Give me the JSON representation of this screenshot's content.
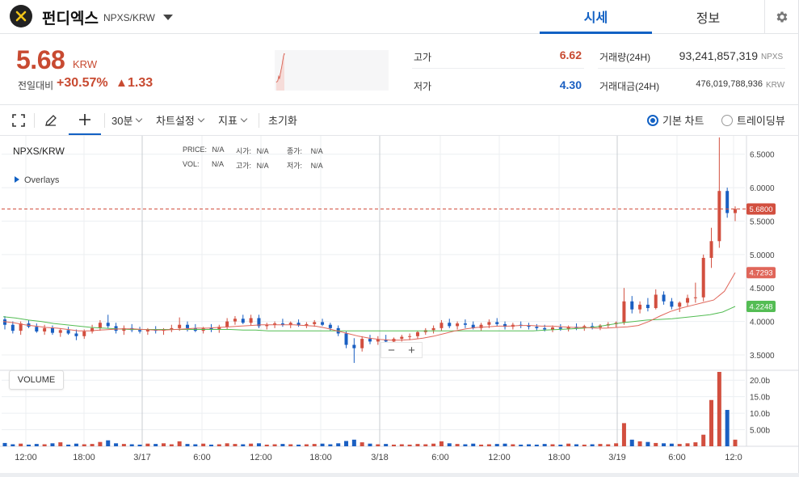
{
  "header": {
    "coin_name": "펀디엑스",
    "pair": "NPXS/KRW",
    "tabs": [
      "시세",
      "정보"
    ]
  },
  "summary": {
    "price": "5.68",
    "price_unit": "KRW",
    "change_label": "전일대비",
    "change_rate": "+30.57%",
    "change_arrow": "▲",
    "change_amount": "1.33",
    "high_label": "고가",
    "high_value": "6.62",
    "low_label": "저가",
    "low_value": "4.30",
    "volume_label": "거래량(24H)",
    "volume_value": "93,241,857,319",
    "volume_unit": "NPXS",
    "amount_label": "거래대금(24H)",
    "amount_value": "476,019,788,936",
    "amount_unit": "KRW"
  },
  "toolbar": {
    "interval": "30분",
    "chart_settings": "차트설정",
    "indicators": "지표",
    "reset": "초기화",
    "basic_chart": "기본 차트",
    "tradingview": "트레이딩뷰"
  },
  "chart": {
    "symbol": "NPXS/KRW",
    "ohlc_rows": [
      [
        {
          "k": "PRICE:",
          "v": "N/A"
        },
        {
          "k": "시가:",
          "v": "N/A"
        },
        {
          "k": "종가:",
          "v": "N/A"
        }
      ],
      [
        {
          "k": "VOL:",
          "v": "N/A"
        },
        {
          "k": "고가:",
          "v": "N/A"
        },
        {
          "k": "저가:",
          "v": "N/A"
        }
      ]
    ],
    "overlays_label": "Overlays",
    "volume_label": "VOLUME",
    "zoom_out": "−",
    "zoom_in": "+",
    "price_ticks": [
      "6.5000",
      "6.0000",
      "5.5000",
      "5.0000",
      "4.5000",
      "4.0000",
      "3.5000"
    ],
    "volume_ticks": [
      "20.0b",
      "15.0b",
      "10.0b",
      "5.00b"
    ],
    "time_ticks": [
      "12:00",
      "18:00",
      "3/17",
      "6:00",
      "12:00",
      "18:00",
      "3/18",
      "6:00",
      "12:00",
      "18:00",
      "3/19",
      "6:00",
      "12:0"
    ],
    "last_price_label": "5.6800",
    "ma_short_label": "4.7293",
    "ma_long_label": "4.2248",
    "colors": {
      "up": "#d24f3f",
      "down": "#1a5fc2",
      "ma_short": "#e0665a",
      "ma_long": "#54bd54",
      "last": "#d24f3f"
    }
  },
  "chart_data": {
    "type": "candlestick",
    "price_range": [
      3.27,
      6.75
    ],
    "volume_range_b": [
      0,
      22.5
    ],
    "last_price": 5.68,
    "ma_short_last": 4.7293,
    "ma_long_last": 4.2248,
    "ohlc": [
      [
        4.03,
        4.08,
        3.88,
        3.95
      ],
      [
        3.95,
        4.0,
        3.82,
        3.86
      ],
      [
        3.86,
        4.0,
        3.8,
        3.97
      ],
      [
        3.97,
        4.02,
        3.9,
        3.92
      ],
      [
        3.92,
        3.97,
        3.83,
        3.85
      ],
      [
        3.85,
        3.95,
        3.8,
        3.9
      ],
      [
        3.9,
        3.94,
        3.8,
        3.83
      ],
      [
        3.83,
        3.9,
        3.77,
        3.87
      ],
      [
        3.87,
        3.92,
        3.8,
        3.82
      ],
      [
        3.82,
        3.88,
        3.72,
        3.78
      ],
      [
        3.78,
        3.88,
        3.74,
        3.85
      ],
      [
        3.85,
        3.95,
        3.82,
        3.9
      ],
      [
        3.9,
        4.02,
        3.86,
        3.98
      ],
      [
        3.98,
        4.1,
        3.9,
        3.93
      ],
      [
        3.93,
        3.98,
        3.82,
        3.86
      ],
      [
        3.86,
        3.94,
        3.8,
        3.9
      ],
      [
        3.9,
        3.96,
        3.84,
        3.87
      ],
      [
        3.87,
        3.92,
        3.82,
        3.85
      ],
      [
        3.85,
        3.9,
        3.8,
        3.88
      ],
      [
        3.88,
        3.93,
        3.82,
        3.86
      ],
      [
        3.86,
        3.9,
        3.8,
        3.88
      ],
      [
        3.88,
        3.95,
        3.84,
        3.9
      ],
      [
        3.9,
        4.06,
        3.86,
        3.95
      ],
      [
        3.95,
        4.0,
        3.85,
        3.9
      ],
      [
        3.9,
        3.96,
        3.84,
        3.86
      ],
      [
        3.86,
        3.92,
        3.82,
        3.9
      ],
      [
        3.9,
        3.96,
        3.84,
        3.88
      ],
      [
        3.88,
        3.95,
        3.83,
        3.92
      ],
      [
        3.92,
        4.05,
        3.88,
        4.0
      ],
      [
        4.0,
        4.08,
        3.95,
        4.04
      ],
      [
        4.04,
        4.1,
        3.96,
        3.98
      ],
      [
        3.98,
        4.1,
        3.94,
        4.05
      ],
      [
        4.05,
        4.1,
        3.9,
        3.93
      ],
      [
        3.93,
        3.98,
        3.88,
        3.95
      ],
      [
        3.95,
        4.0,
        3.9,
        3.97
      ],
      [
        3.97,
        4.04,
        3.92,
        3.95
      ],
      [
        3.95,
        4.0,
        3.9,
        3.98
      ],
      [
        3.98,
        4.03,
        3.92,
        3.94
      ],
      [
        3.94,
        3.99,
        3.9,
        3.96
      ],
      [
        3.96,
        4.02,
        3.92,
        3.99
      ],
      [
        3.99,
        4.04,
        3.93,
        3.95
      ],
      [
        3.95,
        3.98,
        3.86,
        3.9
      ],
      [
        3.9,
        3.94,
        3.78,
        3.82
      ],
      [
        3.82,
        3.85,
        3.6,
        3.65
      ],
      [
        3.65,
        3.75,
        3.38,
        3.6
      ],
      [
        3.6,
        3.78,
        3.55,
        3.74
      ],
      [
        3.74,
        3.8,
        3.66,
        3.7
      ],
      [
        3.7,
        3.78,
        3.65,
        3.73
      ],
      [
        3.73,
        3.8,
        3.68,
        3.7
      ],
      [
        3.7,
        3.76,
        3.66,
        3.74
      ],
      [
        3.74,
        3.8,
        3.7,
        3.77
      ],
      [
        3.77,
        3.82,
        3.72,
        3.78
      ],
      [
        3.78,
        3.86,
        3.74,
        3.84
      ],
      [
        3.84,
        3.9,
        3.8,
        3.87
      ],
      [
        3.87,
        3.94,
        3.82,
        3.9
      ],
      [
        3.9,
        4.02,
        3.86,
        3.98
      ],
      [
        3.98,
        4.04,
        3.9,
        3.93
      ],
      [
        3.93,
        4.0,
        3.88,
        3.97
      ],
      [
        3.97,
        4.03,
        3.9,
        3.95
      ],
      [
        3.95,
        4.0,
        3.88,
        3.9
      ],
      [
        3.9,
        3.98,
        3.86,
        3.95
      ],
      [
        3.95,
        4.03,
        3.9,
        3.99
      ],
      [
        3.99,
        4.05,
        3.93,
        3.96
      ],
      [
        3.96,
        4.0,
        3.88,
        3.92
      ],
      [
        3.92,
        3.98,
        3.88,
        3.95
      ],
      [
        3.95,
        4.0,
        3.9,
        3.94
      ],
      [
        3.94,
        3.98,
        3.88,
        3.92
      ],
      [
        3.92,
        3.96,
        3.86,
        3.9
      ],
      [
        3.9,
        3.95,
        3.85,
        3.88
      ],
      [
        3.88,
        3.94,
        3.84,
        3.91
      ],
      [
        3.91,
        3.96,
        3.86,
        3.89
      ],
      [
        3.89,
        3.94,
        3.85,
        3.92
      ],
      [
        3.92,
        3.97,
        3.87,
        3.9
      ],
      [
        3.9,
        3.95,
        3.86,
        3.93
      ],
      [
        3.93,
        3.98,
        3.88,
        3.91
      ],
      [
        3.91,
        3.96,
        3.87,
        3.94
      ],
      [
        3.94,
        3.99,
        3.9,
        3.96
      ],
      [
        3.96,
        4.0,
        3.91,
        3.98
      ],
      [
        3.98,
        4.5,
        3.95,
        4.3
      ],
      [
        4.3,
        4.38,
        4.12,
        4.18
      ],
      [
        4.18,
        4.3,
        4.12,
        4.25
      ],
      [
        4.25,
        4.35,
        4.15,
        4.2
      ],
      [
        4.2,
        4.48,
        4.18,
        4.4
      ],
      [
        4.4,
        4.45,
        4.25,
        4.3
      ],
      [
        4.3,
        4.35,
        4.18,
        4.22
      ],
      [
        4.22,
        4.3,
        4.14,
        4.28
      ],
      [
        4.28,
        4.4,
        4.22,
        4.35
      ],
      [
        4.35,
        4.58,
        4.28,
        4.36
      ],
      [
        4.36,
        5.0,
        4.3,
        4.95
      ],
      [
        4.95,
        5.4,
        4.8,
        5.2
      ],
      [
        5.2,
        6.75,
        5.1,
        5.95
      ],
      [
        5.95,
        6.0,
        5.55,
        5.62
      ],
      [
        5.62,
        5.72,
        5.5,
        5.68
      ]
    ],
    "volume_b": [
      1.0,
      0.6,
      0.8,
      0.5,
      0.7,
      0.6,
      0.9,
      1.2,
      0.5,
      0.8,
      0.6,
      0.7,
      1.3,
      1.8,
      0.9,
      0.7,
      0.6,
      0.5,
      0.8,
      0.7,
      0.9,
      0.6,
      1.5,
      0.7,
      0.6,
      0.8,
      0.5,
      0.6,
      0.9,
      0.7,
      0.6,
      0.8,
      0.9,
      0.5,
      0.6,
      0.7,
      0.6,
      0.5,
      0.6,
      0.7,
      0.8,
      0.6,
      0.9,
      1.6,
      2.0,
      1.2,
      0.8,
      0.6,
      0.7,
      0.5,
      0.6,
      0.5,
      0.7,
      0.6,
      0.8,
      1.5,
      0.9,
      0.7,
      0.6,
      0.8,
      0.5,
      0.6,
      0.7,
      0.8,
      0.6,
      0.5,
      0.6,
      0.5,
      0.7,
      0.6,
      0.5,
      0.8,
      0.6,
      0.5,
      0.6,
      0.7,
      0.6,
      0.9,
      7.0,
      2.0,
      1.5,
      1.3,
      1.0,
      0.9,
      0.8,
      0.7,
      0.9,
      1.2,
      3.5,
      14.0,
      22.5,
      11.0,
      2.0
    ],
    "ma_short": [
      4.0,
      3.98,
      3.95,
      3.93,
      3.91,
      3.9,
      3.88,
      3.86,
      3.86,
      3.87,
      3.88,
      3.89,
      3.89,
      3.88,
      3.87,
      3.87,
      3.88,
      3.89,
      3.9,
      3.9,
      3.91,
      3.92,
      3.93,
      3.94,
      3.95,
      3.95,
      3.95,
      3.95,
      3.94,
      3.93,
      3.9,
      3.86,
      3.82,
      3.78,
      3.75,
      3.73,
      3.72,
      3.72,
      3.73,
      3.75,
      3.78,
      3.82,
      3.86,
      3.89,
      3.91,
      3.92,
      3.93,
      3.93,
      3.94,
      3.94,
      3.93,
      3.93,
      3.92,
      3.91,
      3.91,
      3.9,
      3.9,
      3.91,
      3.92,
      3.94,
      4.0,
      4.08,
      4.15,
      4.2,
      4.24,
      4.28,
      4.32,
      4.45,
      4.7293
    ],
    "ma_long": [
      4.07,
      4.05,
      4.02,
      4.0,
      3.97,
      3.95,
      3.93,
      3.91,
      3.9,
      3.89,
      3.88,
      3.88,
      3.88,
      3.88,
      3.88,
      3.88,
      3.88,
      3.88,
      3.88,
      3.87,
      3.87,
      3.86,
      3.86,
      3.86,
      3.86,
      3.86,
      3.86,
      3.86,
      3.86,
      3.86,
      3.86,
      3.86,
      3.86,
      3.86,
      3.86,
      3.86,
      3.86,
      3.86,
      3.86,
      3.86,
      3.86,
      3.86,
      3.86,
      3.87,
      3.88,
      3.89,
      3.9,
      3.92,
      3.95,
      3.98,
      4.0,
      4.02,
      4.03,
      4.04,
      4.06,
      4.08,
      4.1,
      4.14,
      4.2248
    ]
  }
}
